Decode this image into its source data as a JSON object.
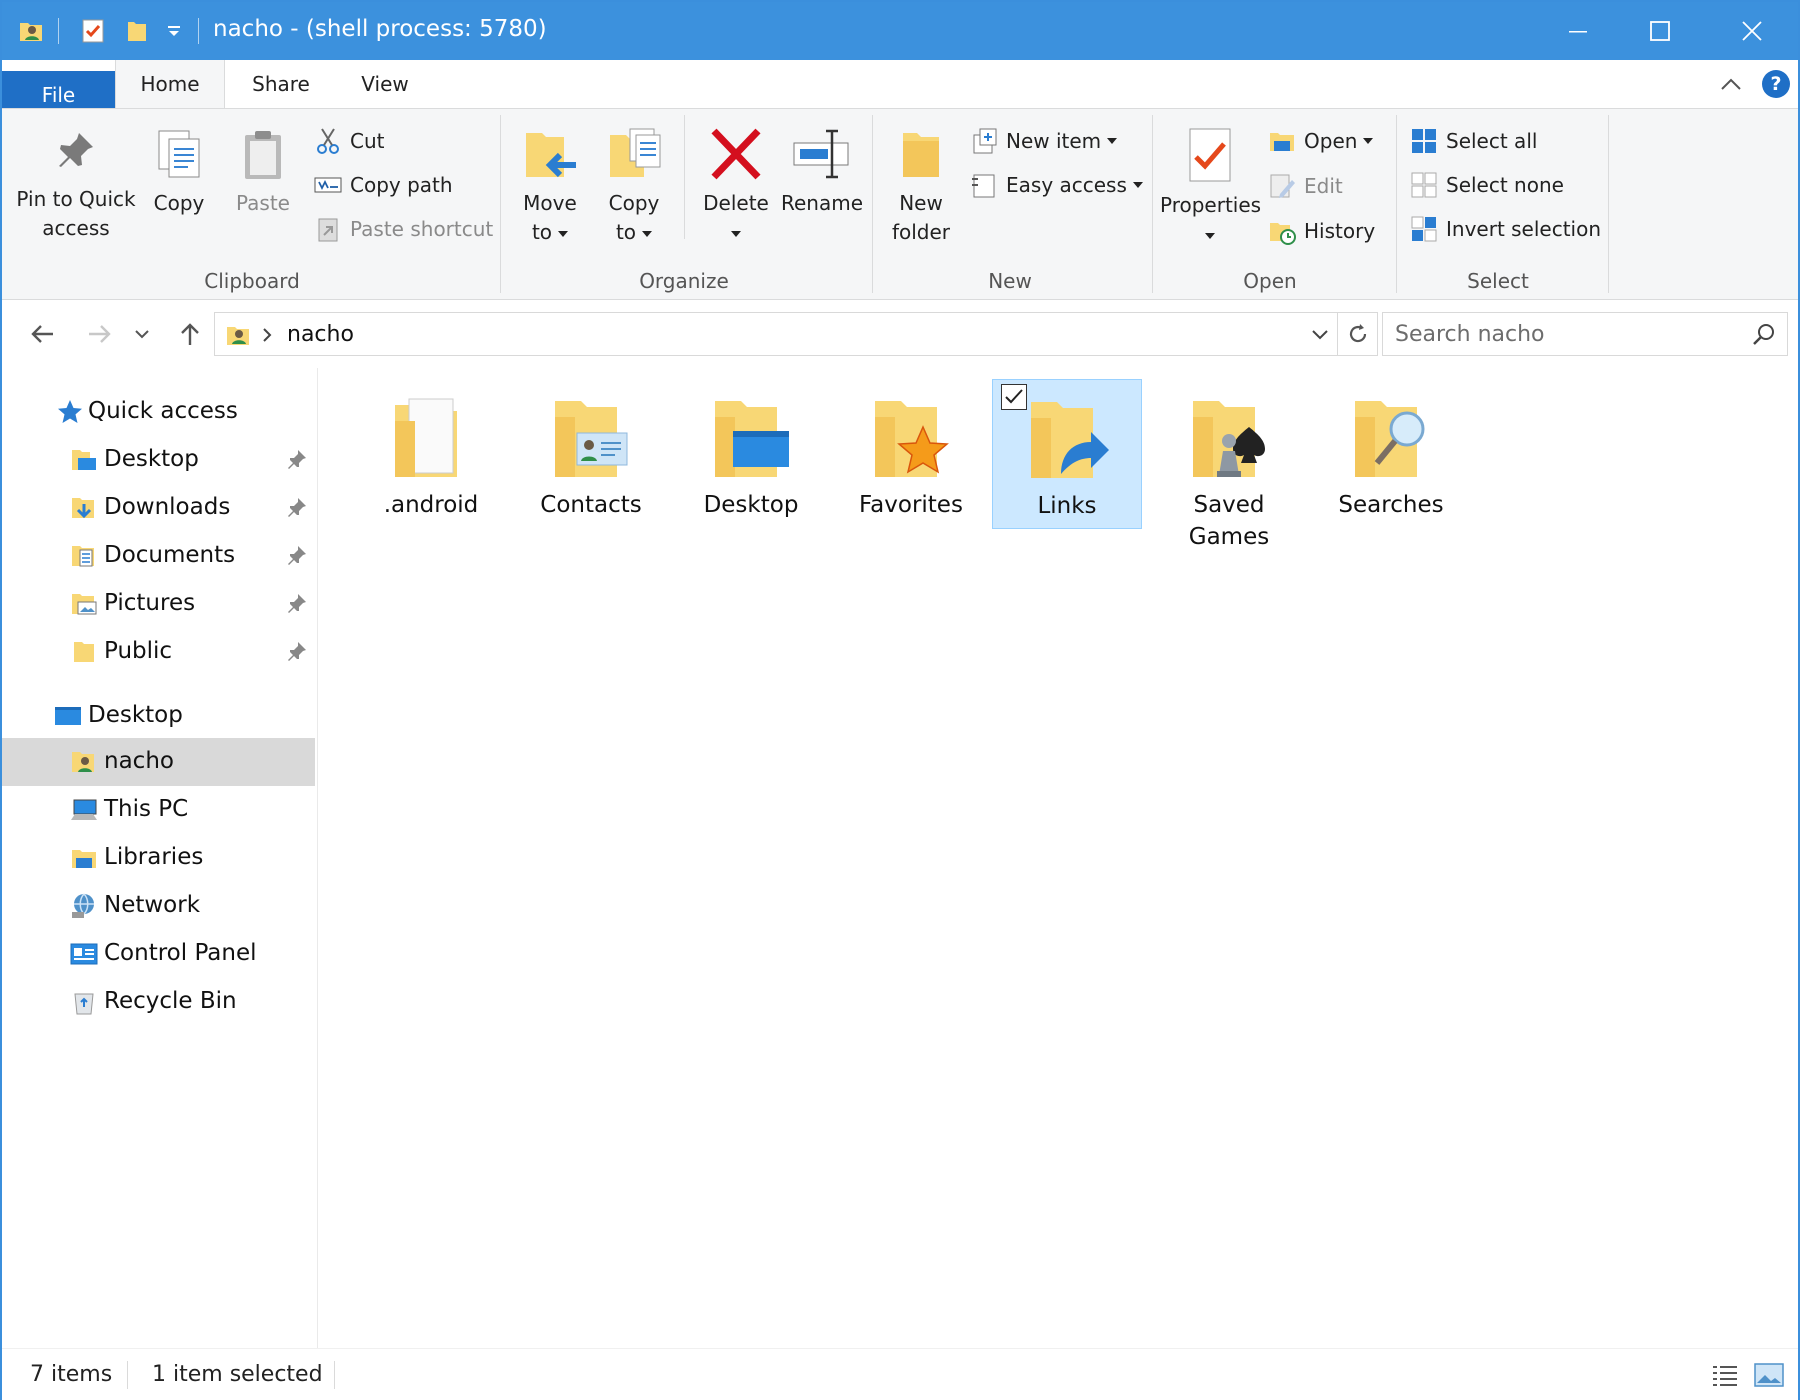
{
  "window": {
    "title": "nacho - (shell process: 5780)"
  },
  "tabs": {
    "file": "File",
    "home": "Home",
    "share": "Share",
    "view": "View"
  },
  "ribbon": {
    "clipboard": {
      "label": "Clipboard",
      "pin_line1": "Pin to Quick",
      "pin_line2": "access",
      "copy": "Copy",
      "paste": "Paste",
      "cut": "Cut",
      "copy_path": "Copy path",
      "paste_shortcut": "Paste shortcut"
    },
    "organize": {
      "label": "Organize",
      "move_line1": "Move",
      "move_line2": "to",
      "copy_line1": "Copy",
      "copy_line2": "to",
      "delete": "Delete",
      "rename": "Rename"
    },
    "new": {
      "label": "New",
      "folder_line1": "New",
      "folder_line2": "folder",
      "new_item": "New item",
      "easy_access": "Easy access"
    },
    "open": {
      "label": "Open",
      "properties": "Properties",
      "open": "Open",
      "edit": "Edit",
      "history": "History"
    },
    "select": {
      "label": "Select",
      "select_all": "Select all",
      "select_none": "Select none",
      "invert": "Invert selection"
    }
  },
  "address": {
    "crumb": "nacho",
    "search_placeholder": "Search nacho"
  },
  "sidebar": {
    "quick_access": "Quick access",
    "pinned": [
      "Desktop",
      "Downloads",
      "Documents",
      "Pictures",
      "Public"
    ],
    "desktop": "Desktop",
    "tree": [
      "nacho",
      "This PC",
      "Libraries",
      "Network",
      "Control Panel",
      "Recycle Bin"
    ]
  },
  "files": [
    {
      "line1": ".android",
      "line2": ""
    },
    {
      "line1": "Contacts",
      "line2": ""
    },
    {
      "line1": "Desktop",
      "line2": ""
    },
    {
      "line1": "Favorites",
      "line2": ""
    },
    {
      "line1": "Links",
      "line2": ""
    },
    {
      "line1": "Saved",
      "line2": "Games"
    },
    {
      "line1": "Searches",
      "line2": ""
    }
  ],
  "status": {
    "count": "7 items",
    "selected": "1 item selected"
  },
  "colors": {
    "titlebar": "#3c91dd",
    "file_tab": "#1f6fc6",
    "selection": "#cce8ff",
    "folder": "#f8d775"
  }
}
